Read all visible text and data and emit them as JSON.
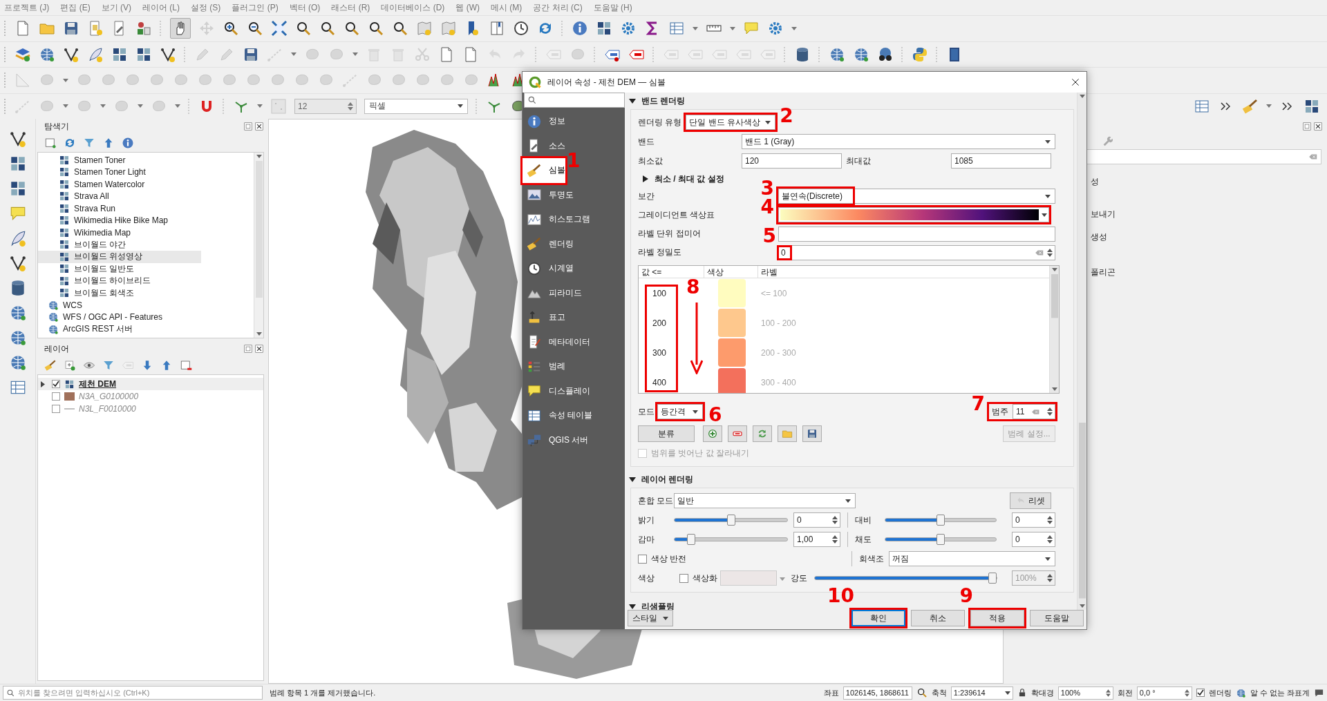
{
  "menu_bar": [
    "프로젝트 (J)",
    "편집 (E)",
    "보기 (V)",
    "레이어 (L)",
    "설정 (S)",
    "플러그인 (P)",
    "벡터 (O)",
    "래스터 (R)",
    "데이터베이스 (D)",
    "웹 (W)",
    "메시 (M)",
    "공간 처리 (C)",
    "도움말 (H)"
  ],
  "snapping_toolbar": {
    "tolerance": "12",
    "unit": "픽셀"
  },
  "browser_panel": {
    "title": "탐색기",
    "items": [
      {
        "label": "Stamen Toner",
        "kind": "tile",
        "selected": false
      },
      {
        "label": "Stamen Toner Light",
        "kind": "tile",
        "selected": false
      },
      {
        "label": "Stamen Watercolor",
        "kind": "tile",
        "selected": false
      },
      {
        "label": "Strava All",
        "kind": "tile",
        "selected": false
      },
      {
        "label": "Strava Run",
        "kind": "tile",
        "selected": false
      },
      {
        "label": "Wikimedia Hike Bike Map",
        "kind": "tile",
        "selected": false
      },
      {
        "label": "Wikimedia Map",
        "kind": "tile",
        "selected": false
      },
      {
        "label": "브이월드 야간",
        "kind": "tile",
        "selected": false
      },
      {
        "label": "브이월드 위성영상",
        "kind": "tile",
        "selected": true
      },
      {
        "label": "브이월드 일반도",
        "kind": "tile",
        "selected": false
      },
      {
        "label": "브이월드 하이브리드",
        "kind": "tile",
        "selected": false
      },
      {
        "label": "브이월드 회색조",
        "kind": "tile",
        "selected": false
      },
      {
        "label": "WCS",
        "kind": "service",
        "selected": false
      },
      {
        "label": "WFS / OGC API - Features",
        "kind": "service",
        "selected": false
      },
      {
        "label": "ArcGIS REST 서버",
        "kind": "service",
        "selected": false
      }
    ]
  },
  "layers_panel": {
    "title": "레이어",
    "layers": [
      {
        "name": "제천 DEM",
        "kind": "raster",
        "checked": true,
        "selected": true,
        "expanded": false
      },
      {
        "name": "N3A_G0100000",
        "kind": "polygon",
        "checked": false,
        "selected": false,
        "color": "#a0705a"
      },
      {
        "name": "N3L_F0010000",
        "kind": "line",
        "checked": false,
        "selected": false,
        "color": "#c0c0c0"
      }
    ]
  },
  "right_panel": {
    "items": [
      "성",
      "보내기",
      "생성",
      "폴리곤"
    ]
  },
  "dialog": {
    "title": "레이어 속성 - 제천 DEM — 심볼",
    "sidebar": [
      {
        "label": "정보",
        "selected": false
      },
      {
        "label": "소스",
        "selected": false
      },
      {
        "label": "심볼",
        "selected": true,
        "annotation": "1"
      },
      {
        "label": "투명도",
        "selected": false
      },
      {
        "label": "히스토그램",
        "selected": false
      },
      {
        "label": "렌더링",
        "selected": false
      },
      {
        "label": "시계열",
        "selected": false
      },
      {
        "label": "피라미드",
        "selected": false
      },
      {
        "label": "표고",
        "selected": false
      },
      {
        "label": "메타데이터",
        "selected": false
      },
      {
        "label": "범례",
        "selected": false
      },
      {
        "label": "디스플레이",
        "selected": false
      },
      {
        "label": "속성 테이블",
        "selected": false
      },
      {
        "label": "QGIS 서버",
        "selected": false
      }
    ],
    "band_rendering": {
      "title": "밴드 렌더링",
      "expanded": true,
      "render_type": {
        "label": "렌더링 유형",
        "value": "단일 밴드 유사색상",
        "annotation": "2"
      },
      "band": {
        "label": "밴드",
        "value": "밴드 1 (Gray)"
      },
      "min": {
        "label": "최소값",
        "value": "120"
      },
      "max": {
        "label": "최대값",
        "value": "1085"
      },
      "minmax_settings": {
        "label": "최소 / 최대 값 설정",
        "expanded": false
      },
      "interpolation": {
        "label": "보간",
        "value": "불연속(Discrete)",
        "annotation": "3"
      },
      "color_ramp": {
        "label": "그레이디언트 색상표",
        "annotation": "4"
      },
      "label_suffix": {
        "label": "라벨 단위 접미어"
      },
      "label_precision": {
        "label": "라벨 정밀도",
        "value": "0",
        "annotation": "5"
      },
      "table": {
        "columns": [
          "값 <=",
          "색상",
          "라벨"
        ],
        "annotation": "8",
        "rows": [
          {
            "value": "100",
            "color": "#fffcbf",
            "label": "<= 100"
          },
          {
            "value": "200",
            "color": "#fec88d",
            "label": "100 - 200"
          },
          {
            "value": "300",
            "color": "#fd9b6c",
            "label": "200 - 300"
          },
          {
            "value": "400",
            "color": "#f3705c",
            "label": "300 - 400"
          }
        ]
      },
      "mode": {
        "label": "모드",
        "value": "등간격",
        "annotation": "6"
      },
      "classes": {
        "label": "범주",
        "value": "11",
        "annotation": "7"
      },
      "classify_button": "분류",
      "legend_settings_button": {
        "label": "범례 설정...",
        "disabled": true
      },
      "clip_checkbox": {
        "label": "범위를 벗어난 값 잘라내기",
        "checked": false,
        "disabled": true
      }
    },
    "layer_rendering": {
      "title": "레이어 렌더링",
      "expanded": true,
      "blend_mode": {
        "label": "혼합 모드",
        "value": "일반"
      },
      "reset_button": "리셋",
      "brightness": {
        "label": "밝기",
        "level": 0.5,
        "value": "0"
      },
      "contrast": {
        "label": "대비",
        "level": 0.5,
        "value": "0"
      },
      "gamma": {
        "label": "감마",
        "level": 0.12,
        "value": "1,00"
      },
      "saturation": {
        "label": "채도",
        "level": 0.5,
        "value": "0"
      },
      "invert": {
        "label": "색상 반전",
        "checked": false
      },
      "grayscale": {
        "label": "회색조",
        "value": "꺼짐"
      },
      "hue_label": "색상",
      "colorize": {
        "label": "색상화",
        "checked": false
      },
      "strength": {
        "label": "강도",
        "level": 1,
        "value": "100%",
        "disabled": true
      }
    },
    "resampling": {
      "title": "리샘플링",
      "expanded": true
    },
    "style_button": "스타일",
    "buttons": [
      {
        "label": "확인",
        "default": true,
        "annotation": "10"
      },
      {
        "label": "취소",
        "default": false
      },
      {
        "label": "적용",
        "default": false,
        "annotation": "9"
      },
      {
        "label": "도움말",
        "default": false
      }
    ]
  },
  "status_bar": {
    "search_placeholder": "위치를 찾으려면 입력하십시오 (Ctrl+K)",
    "message": "범례 항목 1 개를 제거했습니다.",
    "coordinate_label": "좌표",
    "coordinate": "1026145, 1868611",
    "scale_label": "축척",
    "scale": "1:239614",
    "magnifier_label": "확대경",
    "magnifier": "100%",
    "rotation_label": "회전",
    "rotation": "0,0 °",
    "render": {
      "label": "렌더링",
      "checked": true
    },
    "crs": "알 수 없는 좌표계"
  }
}
